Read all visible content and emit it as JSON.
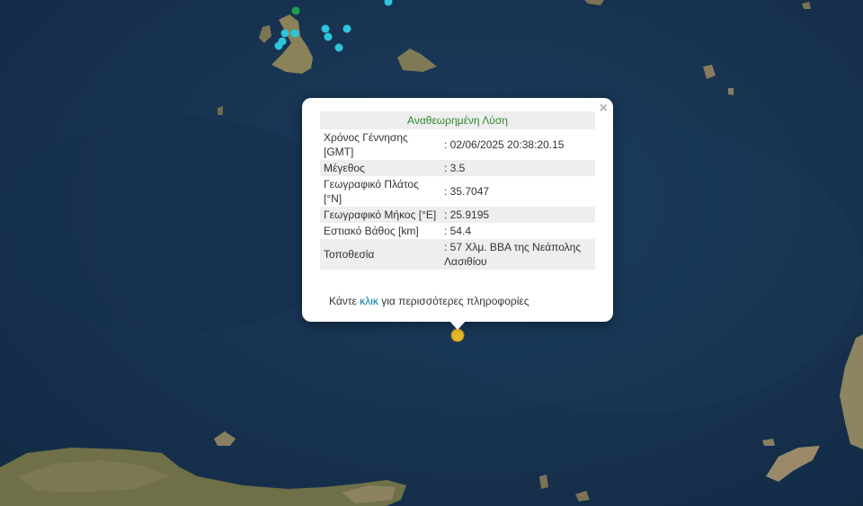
{
  "map": {
    "colors": {
      "sea": "#17324f",
      "land": "#7a7550",
      "quake_recent": "#2ec4dc",
      "quake_green": "#1e9e52",
      "quake_selected": "#e8b92a"
    }
  },
  "popup": {
    "title": "Αναθεωρημένη Λύση",
    "rows": [
      {
        "label": "Χρόνος Γέννησης [GMT]",
        "value": ": 02/06/2025 20:38:20.15"
      },
      {
        "label": "Μέγεθος",
        "value": ": 3.5"
      },
      {
        "label": "Γεωγραφικό Πλάτος [°N]",
        "value": ": 35.7047"
      },
      {
        "label": "Γεωγραφικό Μήκος [°E]",
        "value": ": 25.9195"
      },
      {
        "label": "Εστιακό Βάθος [km]",
        "value": ": 54.4"
      },
      {
        "label": "Τοποθεσία",
        "value": ": 57 Χλμ. ΒΒΑ της Νεάπολης Λασιθίου"
      }
    ],
    "more_prefix": "Κάντε ",
    "more_link": "κλικ",
    "more_suffix": " για περισσότερες πληροφορίες",
    "close": "×"
  }
}
